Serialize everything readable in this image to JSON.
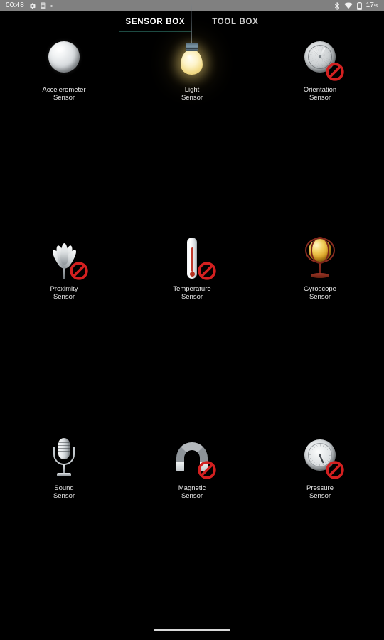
{
  "status_bar": {
    "clock": "00:48",
    "left_icons": [
      "gear-icon",
      "sim-card-icon",
      "dot-icon"
    ],
    "right_icons": [
      "bluetooth-icon",
      "wifi-icon",
      "battery-icon"
    ],
    "battery_percent": "17",
    "battery_unit": "%",
    "background_color": "#808080"
  },
  "tabs": [
    {
      "label": "SENSOR BOX",
      "active": true
    },
    {
      "label": "TOOL BOX",
      "active": false
    }
  ],
  "tab_indicator_color": "#1d4a42",
  "sensors": [
    {
      "name": "Accelerometer\nSensor",
      "icon": "sphere-ball-icon",
      "disabled": false
    },
    {
      "name": "Light\nSensor",
      "icon": "lightbulb-icon",
      "disabled": false
    },
    {
      "name": "Orientation\nSensor",
      "icon": "compass-icon",
      "disabled": true
    },
    {
      "name": "Proximity\nSensor",
      "icon": "flower-icon",
      "disabled": true
    },
    {
      "name": "Temperature\nSensor",
      "icon": "thermometer-icon",
      "disabled": true
    },
    {
      "name": "Gyroscope\nSensor",
      "icon": "gyroscope-globe-icon",
      "disabled": false
    },
    {
      "name": "Sound\nSensor",
      "icon": "microphone-icon",
      "disabled": false
    },
    {
      "name": "Magnetic\nSensor",
      "icon": "horseshoe-magnet-icon",
      "disabled": true
    },
    {
      "name": "Pressure\nSensor",
      "icon": "barometer-gauge-icon",
      "disabled": true
    }
  ],
  "nav_bar": {
    "home_indicator": "home-indicator-bar"
  },
  "colors": {
    "background": "#000000",
    "text": "#e8e8e8",
    "disabled_badge": "#d32020"
  }
}
